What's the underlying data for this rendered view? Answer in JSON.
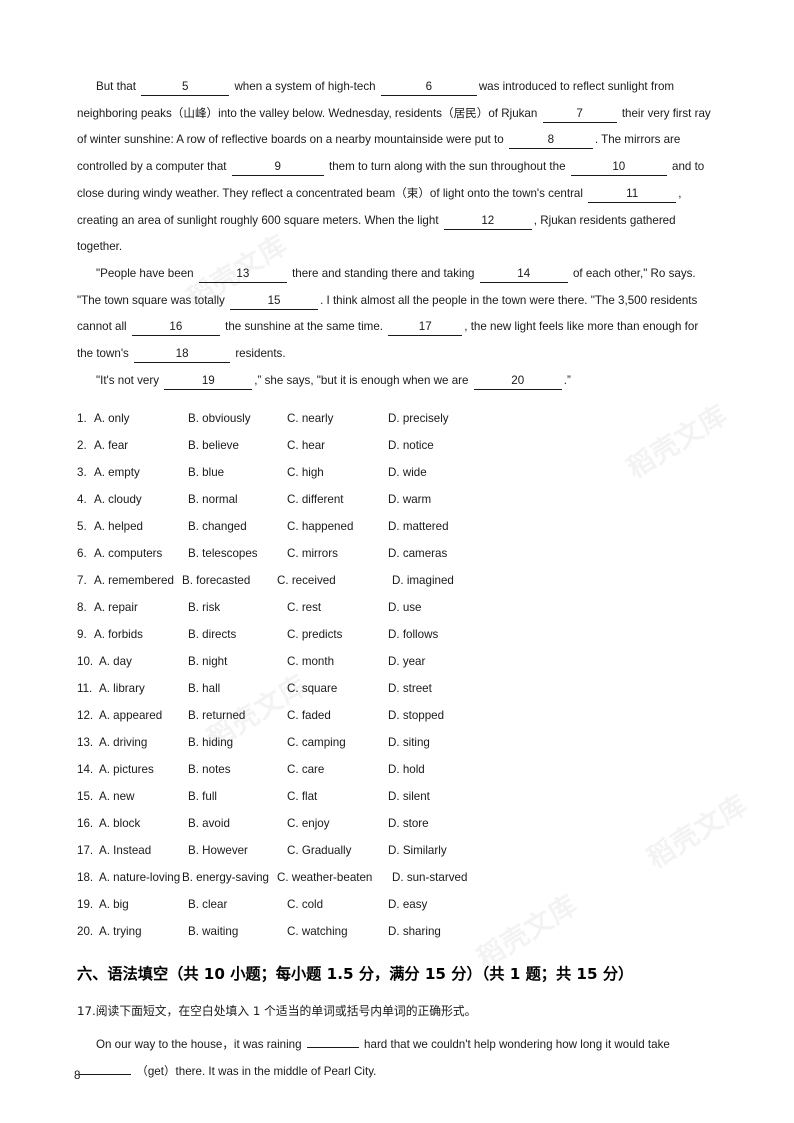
{
  "document": {
    "page_number": "8",
    "watermark_text": "稻壳文库"
  },
  "cloze_passage": {
    "paragraph1": {
      "seg1": "But that",
      "blank1": "5",
      "seg2": "when a system of high-tech",
      "blank2": "6",
      "seg3": "was introduced to reflect sunlight from neighboring peaks（山峰）into the valley below. Wednesday, residents（居民）of Rjukan",
      "blank3": "7",
      "seg4": "their very first ray of winter sunshine: A row of reflective boards on a nearby mountainside were put to",
      "blank4": "8",
      "seg5": ". The mirrors are controlled by a computer that",
      "blank5": "9",
      "seg6": "them to turn along with the sun throughout the",
      "blank6": "10",
      "seg7": "and to close during windy weather. They reflect a concentrated beam（束）of light onto the town's central",
      "blank7": "11",
      "seg8": ", creating an area of sunlight roughly 600 square meters. When the light",
      "blank8": "12",
      "seg9": ", Rjukan residents gathered together."
    },
    "paragraph2": {
      "seg1": "\"People have been",
      "blank1": "13",
      "seg2": "there and standing there and taking",
      "blank2": "14",
      "seg3": "of each other,\" Ro says. \"The town square was totally",
      "blank3": "15",
      "seg4": ". I think almost all the people in the town were there. \"The 3,500 residents cannot all",
      "blank4": "16",
      "seg5": "the sunshine at the same time.",
      "blank5": "17",
      "seg6": ", the new light feels like more than enough for the town's",
      "blank6": "18",
      "seg7": "residents."
    },
    "paragraph3": {
      "seg1": "\"It's not very",
      "blank1": "19",
      "seg2": ",” she says, \"but it is enough when we are",
      "blank2": "20",
      "seg3": ".”"
    }
  },
  "options": [
    {
      "num": "1.",
      "a": "A. only",
      "b": "B. obviously",
      "c": "C. nearly",
      "d": "D. precisely"
    },
    {
      "num": "2.",
      "a": "A. fear",
      "b": "B. believe",
      "c": "C. hear",
      "d": "D. notice"
    },
    {
      "num": "3.",
      "a": "A. empty",
      "b": "B. blue",
      "c": "C. high",
      "d": "D. wide"
    },
    {
      "num": "4.",
      "a": "A. cloudy",
      "b": "B. normal",
      "c": "C. different",
      "d": "D. warm"
    },
    {
      "num": "5.",
      "a": "A. helped",
      "b": "B. changed",
      "c": "C. happened",
      "d": "D. mattered"
    },
    {
      "num": "6.",
      "a": "A. computers",
      "b": "B. telescopes",
      "c": "C. mirrors",
      "d": "D. cameras"
    },
    {
      "num": "7.",
      "a": "A. remembered",
      "b": "B. forecasted",
      "c": "C. received",
      "d": "D. imagined"
    },
    {
      "num": "8.",
      "a": "A. repair",
      "b": "B. risk",
      "c": "C. rest",
      "d": "D. use"
    },
    {
      "num": "9.",
      "a": "A. forbids",
      "b": "B. directs",
      "c": "C. predicts",
      "d": "D. follows"
    },
    {
      "num": "10.",
      "a": "A. day",
      "b": "B. night",
      "c": "C. month",
      "d": "D. year"
    },
    {
      "num": "11.",
      "a": "A. library",
      "b": "B. hall",
      "c": "C. square",
      "d": "D. street"
    },
    {
      "num": "12.",
      "a": "A. appeared",
      "b": "B. returned",
      "c": "C. faded",
      "d": "D. stopped"
    },
    {
      "num": "13.",
      "a": "A. driving",
      "b": "B. hiding",
      "c": "C. camping",
      "d": "D. siting"
    },
    {
      "num": "14.",
      "a": "A. pictures",
      "b": "B. notes",
      "c": "C. care",
      "d": "D. hold"
    },
    {
      "num": "15.",
      "a": "A. new",
      "b": "B. full",
      "c": "C. flat",
      "d": "D. silent"
    },
    {
      "num": "16.",
      "a": "A. block",
      "b": "B. avoid",
      "c": "C. enjoy",
      "d": "D. store"
    },
    {
      "num": "17.",
      "a": "A. Instead",
      "b": "B. However",
      "c": "C. Gradually",
      "d": "D. Similarly"
    },
    {
      "num": "18.",
      "a": "A. nature-loving",
      "b": "B. energy-saving",
      "c": "C. weather-beaten",
      "d": "D. sun-starved"
    },
    {
      "num": "19.",
      "a": "A. big",
      "b": "B. clear",
      "c": "C. cold",
      "d": "D. easy"
    },
    {
      "num": "20.",
      "a": "A. trying",
      "b": "B. waiting",
      "c": "C. watching",
      "d": "D. sharing"
    }
  ],
  "grammar_section": {
    "heading": "六、语法填空（共 10 小题；每小题 1.5 分，满分 15 分）（共 1 题；共 15 分）",
    "question_line": "17.阅读下面短文，在空白处填入 1 个适当的单词或括号内单词的正确形式。",
    "passage": {
      "seg1": "On our way to the house，it was raining",
      "seg2": "hard that we couldn't help wondering how long it would take",
      "seg3": "（get）there. It was in the middle of Pearl City."
    }
  }
}
